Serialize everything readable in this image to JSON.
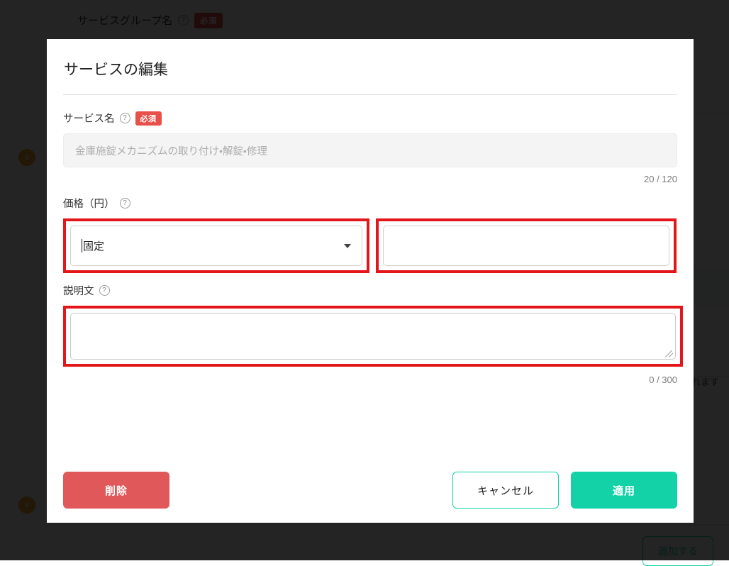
{
  "background": {
    "header_label": "サービスグループ名",
    "header_badge": "必須",
    "note_text": "設定は反映されます",
    "handle_icon_top": "≡",
    "handle_icon_bottom": "≡",
    "outline_button_label": "追加する"
  },
  "modal": {
    "title": "サービスの編集",
    "fields": {
      "service_name": {
        "label": "サービス名",
        "help_icon": "?",
        "required_badge": "必須",
        "value": "金庫施錠メカニズムの取り付け・解錠・修理",
        "counter": "20 / 120"
      },
      "price": {
        "label": "価格（円）",
        "help_icon": "?",
        "type_value": "固定",
        "type_options": [
          "固定"
        ],
        "amount_value": "",
        "dropdown_icon": "chevron-down-icon"
      },
      "description": {
        "label": "説明文",
        "help_icon": "?",
        "value": "",
        "counter": "0 / 300"
      }
    },
    "footer": {
      "delete_label": "削除",
      "cancel_label": "キャンセル",
      "apply_label": "適用"
    }
  },
  "colors": {
    "accent_teal": "#13d2a8",
    "danger_red": "#e0585a",
    "badge_red": "#e8504a",
    "highlight_red": "#e3161a",
    "handle_orange": "#f5a623"
  }
}
